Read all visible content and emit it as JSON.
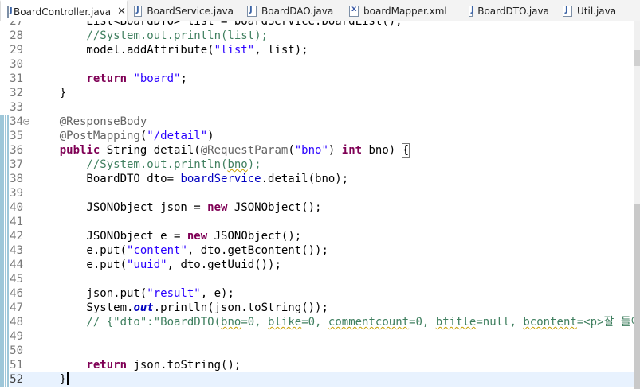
{
  "tabs": [
    {
      "label": "BoardController.java",
      "icon": "java-file-icon",
      "active": true,
      "closable": true
    },
    {
      "label": "BoardService.java",
      "icon": "java-file-icon",
      "active": false
    },
    {
      "label": "BoardDAO.java",
      "icon": "java-file-icon",
      "active": false
    },
    {
      "label": "boardMapper.xml",
      "icon": "xml-file-icon",
      "active": false
    },
    {
      "label": "BoardDTO.java",
      "icon": "java-file-icon",
      "active": false
    },
    {
      "label": "Util.java",
      "icon": "java-file-icon",
      "active": false
    }
  ],
  "close_glyph": "✕",
  "editor": {
    "current_line": "52",
    "fold_line": "34",
    "lines": [
      {
        "n": "27",
        "t": [
          [
            "",
            "        List<BoardDTO> list = boardService.boardList();"
          ]
        ]
      },
      {
        "n": "28",
        "t": [
          [
            "cmt",
            "        //System.out.println(list);"
          ]
        ]
      },
      {
        "n": "29",
        "t": [
          [
            "",
            "        model.addAttribute("
          ],
          [
            "str",
            "\"list\""
          ],
          [
            "",
            ", list);"
          ]
        ]
      },
      {
        "n": "30",
        "t": [
          [
            "",
            ""
          ]
        ]
      },
      {
        "n": "31",
        "t": [
          [
            "",
            "        "
          ],
          [
            "kw",
            "return"
          ],
          [
            "",
            " "
          ],
          [
            "str",
            "\"board\""
          ],
          [
            "",
            ";"
          ]
        ]
      },
      {
        "n": "32",
        "t": [
          [
            "",
            "    }"
          ]
        ]
      },
      {
        "n": "33",
        "t": [
          [
            "",
            ""
          ]
        ]
      },
      {
        "n": "34",
        "t": [
          [
            "ann",
            "    @ResponseBody"
          ]
        ]
      },
      {
        "n": "35",
        "t": [
          [
            "ann",
            "    @PostMapping"
          ],
          [
            "",
            "("
          ],
          [
            "str",
            "\"/detail\""
          ],
          [
            "",
            ")"
          ]
        ]
      },
      {
        "n": "36",
        "t": [
          [
            "",
            "    "
          ],
          [
            "kw",
            "public"
          ],
          [
            "",
            " String detail("
          ],
          [
            "ann",
            "@RequestParam"
          ],
          [
            "",
            "("
          ],
          [
            "str",
            "\"bno\""
          ],
          [
            "",
            ") "
          ],
          [
            "kw",
            "int"
          ],
          [
            "",
            " bno) "
          ],
          [
            "bracket",
            "{"
          ]
        ]
      },
      {
        "n": "37",
        "t": [
          [
            "cmt",
            "        //System.out.println("
          ],
          [
            "cmt sq",
            "bno"
          ],
          [
            "cmt",
            ");"
          ]
        ]
      },
      {
        "n": "38",
        "t": [
          [
            "",
            "        BoardDTO dto= "
          ],
          [
            "fld",
            "boardService"
          ],
          [
            "",
            ".detail(bno);"
          ]
        ]
      },
      {
        "n": "39",
        "t": [
          [
            "",
            ""
          ]
        ]
      },
      {
        "n": "40",
        "t": [
          [
            "",
            "        JSONObject json = "
          ],
          [
            "kw",
            "new"
          ],
          [
            "",
            " JSONObject();"
          ]
        ]
      },
      {
        "n": "41",
        "t": [
          [
            "",
            ""
          ]
        ]
      },
      {
        "n": "42",
        "t": [
          [
            "",
            "        JSONObject e = "
          ],
          [
            "kw",
            "new"
          ],
          [
            "",
            " JSONObject();"
          ]
        ]
      },
      {
        "n": "43",
        "t": [
          [
            "",
            "        e.put("
          ],
          [
            "str",
            "\"content\""
          ],
          [
            "",
            ", dto.getBcontent());"
          ]
        ]
      },
      {
        "n": "44",
        "t": [
          [
            "",
            "        e.put("
          ],
          [
            "str",
            "\"uuid\""
          ],
          [
            "",
            ", dto.getUuid());"
          ]
        ]
      },
      {
        "n": "45",
        "t": [
          [
            "",
            ""
          ]
        ]
      },
      {
        "n": "46",
        "t": [
          [
            "",
            "        json.put("
          ],
          [
            "str",
            "\"result\""
          ],
          [
            "",
            ", e);"
          ]
        ]
      },
      {
        "n": "47",
        "t": [
          [
            "",
            "        System."
          ],
          [
            "sfld",
            "out"
          ],
          [
            "",
            ".println(json.toString());"
          ]
        ]
      },
      {
        "n": "48",
        "t": [
          [
            "cmt",
            "        // {\"dto\":\"BoardDTO("
          ],
          [
            "cmt sq",
            "bno"
          ],
          [
            "cmt",
            "=0, "
          ],
          [
            "cmt sq",
            "blike"
          ],
          [
            "cmt",
            "=0, "
          ],
          [
            "cmt sq",
            "commentcount"
          ],
          [
            "cmt",
            "=0, "
          ],
          [
            "cmt sq",
            "btitle"
          ],
          [
            "cmt",
            "=null, "
          ],
          [
            "cmt sq",
            "bcontent"
          ],
          [
            "cmt",
            "=<p>잘 들어간다"
          ]
        ]
      },
      {
        "n": "49",
        "t": [
          [
            "",
            ""
          ]
        ]
      },
      {
        "n": "50",
        "t": [
          [
            "",
            ""
          ]
        ]
      },
      {
        "n": "51",
        "t": [
          [
            "",
            "        "
          ],
          [
            "kw",
            "return"
          ],
          [
            "",
            " json.toString();"
          ]
        ]
      },
      {
        "n": "52",
        "t": [
          [
            "",
            "    }"
          ],
          [
            "caret",
            ""
          ]
        ]
      }
    ]
  },
  "theme": {
    "keyword": "#7f0055",
    "string": "#2a00ff",
    "comment": "#3f7f5f",
    "annotation": "#646464",
    "field": "#0000c0",
    "current_line_bg": "#e8f2fe"
  }
}
